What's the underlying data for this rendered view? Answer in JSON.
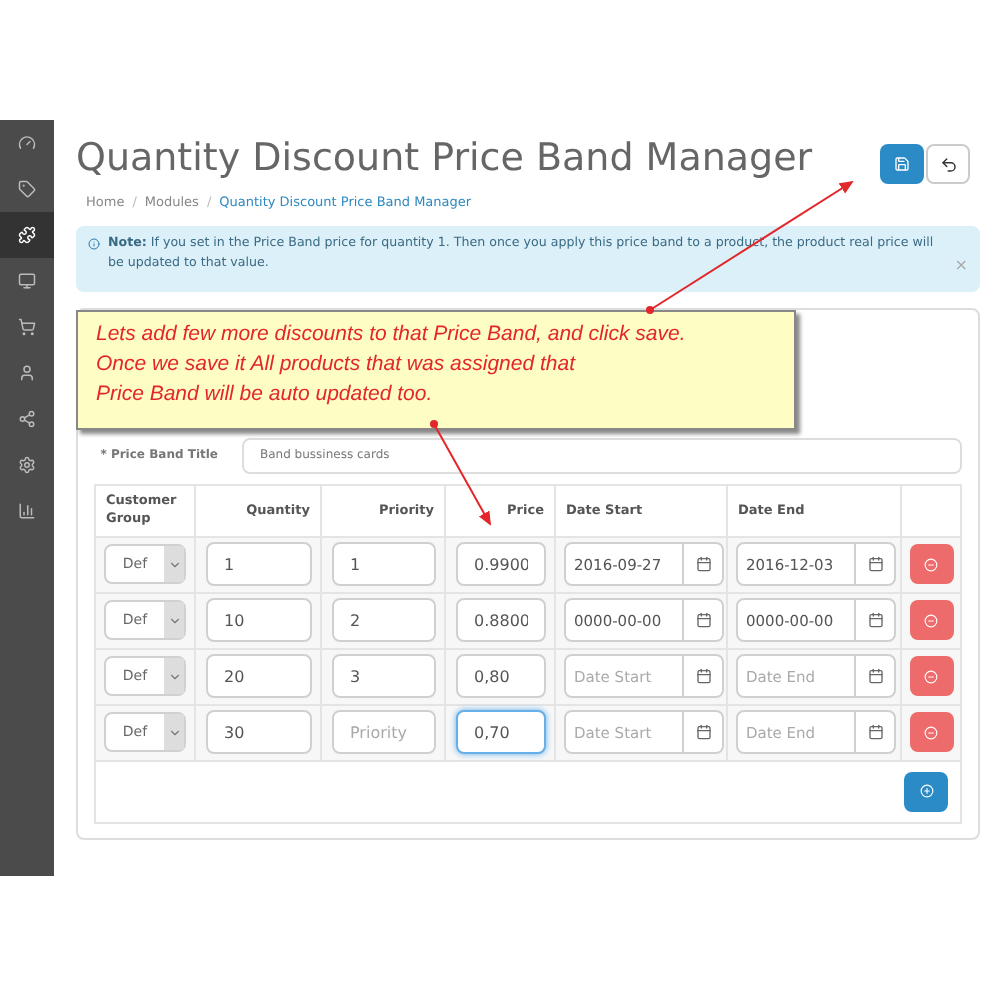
{
  "sidebar": {
    "items": [
      {
        "selected": false
      },
      {
        "selected": false
      },
      {
        "selected": true
      },
      {
        "selected": false
      },
      {
        "selected": false
      },
      {
        "selected": false
      },
      {
        "selected": false
      },
      {
        "selected": false
      },
      {
        "selected": false
      }
    ]
  },
  "page": {
    "title": "Quantity Discount Price Band Manager",
    "breadcrumbs": [
      "Home",
      "Modules",
      "Quantity Discount Price Band Manager"
    ],
    "separator": "/"
  },
  "note": {
    "text": "**Note:** If you set in the Price Band price for quantity 1. Then once you apply this price band to a product, the product real price will be updated to that value.",
    "close": "×"
  },
  "callout": {
    "lines": [
      "Lets add few more discounts to that Price Band, and click save.",
      "Once we save it All products that was assigned that",
      "Price Band will be auto updated too."
    ]
  },
  "form": {
    "title_label": "* Price Band Title",
    "title_value": "Band bussiness cards"
  },
  "table": {
    "columns": [
      "Customer Group",
      "Quantity",
      "Priority",
      "Price",
      "Date Start",
      "Date End"
    ],
    "rows": [
      {
        "group": "Def",
        "quantity": {
          "value": "1"
        },
        "priority": {
          "value": "1"
        },
        "price": {
          "value": "0.9900",
          "focused": false
        },
        "date_start": {
          "value": "2016-09-27"
        },
        "date_end": {
          "value": "2016-12-03"
        }
      },
      {
        "group": "Def",
        "quantity": {
          "value": "10"
        },
        "priority": {
          "value": "2"
        },
        "price": {
          "value": "0.8800",
          "focused": false
        },
        "date_start": {
          "value": "0000-00-00"
        },
        "date_end": {
          "value": "0000-00-00"
        }
      },
      {
        "group": "Def",
        "quantity": {
          "value": "20"
        },
        "priority": {
          "value": "3"
        },
        "price": {
          "value": "0,80",
          "focused": false
        },
        "date_start": {
          "placeholder": "Date Start"
        },
        "date_end": {
          "placeholder": "Date End"
        }
      },
      {
        "group": "Def",
        "quantity": {
          "value": "30"
        },
        "priority": {
          "placeholder": "Priority"
        },
        "price": {
          "value": "0,70",
          "focused": true
        },
        "date_start": {
          "placeholder": "Date Start"
        },
        "date_end": {
          "placeholder": "Date End"
        }
      }
    ]
  }
}
